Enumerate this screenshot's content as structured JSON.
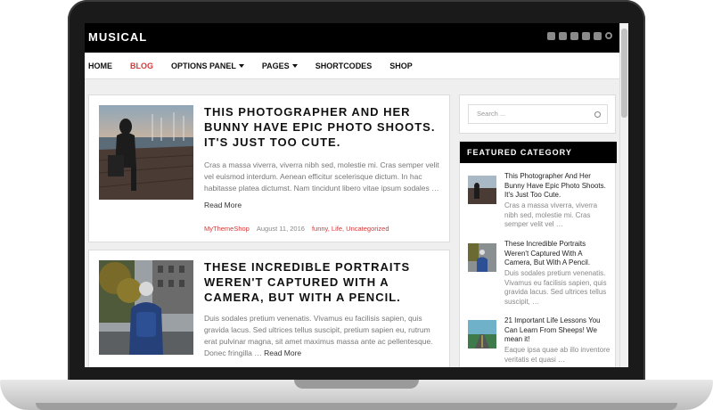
{
  "site": {
    "logo": "MUSICAL"
  },
  "nav": {
    "items": [
      {
        "label": "HOME",
        "active": false,
        "dropdown": false
      },
      {
        "label": "BLOG",
        "active": true,
        "dropdown": false
      },
      {
        "label": "OPTIONS PANEL",
        "active": false,
        "dropdown": true
      },
      {
        "label": "PAGES",
        "active": false,
        "dropdown": true
      },
      {
        "label": "SHORTCODES",
        "active": false,
        "dropdown": false
      },
      {
        "label": "SHOP",
        "active": false,
        "dropdown": false
      }
    ],
    "accent": "#d23a3a"
  },
  "social_icons": [
    "facebook-icon",
    "twitter-icon",
    "instagram-icon",
    "youtube-icon",
    "soundcloud-icon",
    "search-icon"
  ],
  "posts": [
    {
      "title": "THIS PHOTOGRAPHER AND HER BUNNY HAVE EPIC PHOTO SHOOTS. IT'S JUST TOO CUTE.",
      "excerpt": "Cras a massa viverra, viverra nibh sed, molestie mi. Cras semper velit vel euismod interdum. Aenean efficitur scelerisque dictum. In hac habitasse platea dictumst. Nam tincidunt libero vitae ipsum sodales …",
      "read_more": "Read More",
      "author": "MyThemeShop",
      "date": "August 11, 2016",
      "categories": "funny, Life, Uncategorized"
    },
    {
      "title": "THESE INCREDIBLE PORTRAITS WEREN'T CAPTURED WITH A CAMERA, BUT WITH A PENCIL.",
      "excerpt": "Duis sodales pretium venenatis. Vivamus eu facilisis sapien, quis gravida lacus. Sed ultrices tellus suscipit, pretium sapien eu, rutrum erat pulvinar magna, sit amet maximus massa ante ac pellentesque. Donec fringilla …",
      "read_more": "Read More"
    }
  ],
  "sidebar": {
    "search_placeholder": "Search ...",
    "featured_heading": "FEATURED CATEGORY",
    "featured_items": [
      {
        "title": "This Photographer And Her Bunny Have Epic Photo Shoots. It's Just Too Cute.",
        "excerpt": "Cras a massa viverra, viverra nibh sed, molestie mi. Cras semper velit vel …"
      },
      {
        "title": "These Incredible Portraits Weren't Captured With A Camera, But With A Pencil.",
        "excerpt": "Duis sodales pretium venenatis. Vivamus eu facilisis sapien, quis gravida lacus. Sed ultrices tellus suscipit, …"
      },
      {
        "title": "21 Important Life Lessons You Can Learn From Sheeps! We mean it!",
        "excerpt": "Eaque ipsa quae ab illo inventore veritatis et quasi …"
      }
    ]
  }
}
